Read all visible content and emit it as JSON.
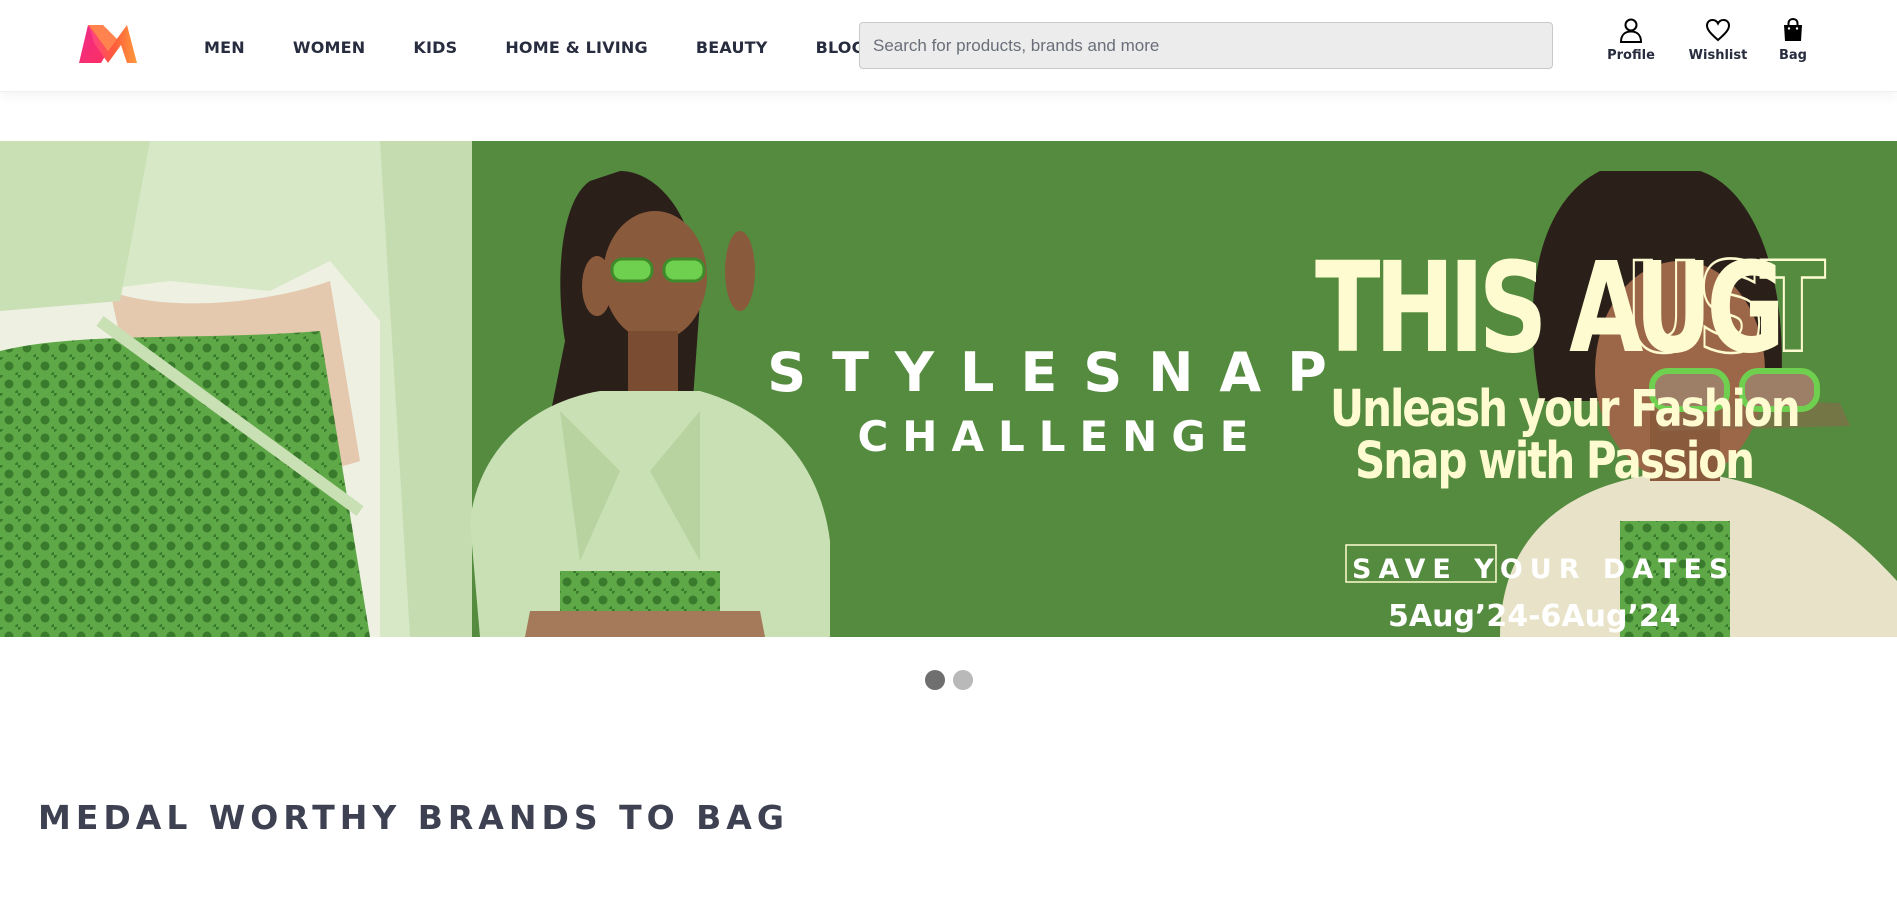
{
  "header": {
    "logo_icon": "myntra-logo-icon",
    "nav": [
      "MEN",
      "WOMEN",
      "KIDS",
      "HOME & LIVING",
      "BEAUTY",
      "BLOGS"
    ],
    "search": {
      "placeholder": "Search for products, brands and more"
    },
    "actions": [
      {
        "label": "Profile",
        "icon": "profile-icon"
      },
      {
        "label": "Wishlist",
        "icon": "heart-icon"
      },
      {
        "label": "Bag",
        "icon": "bag-icon"
      }
    ]
  },
  "banner": {
    "headline_1": "STYLESNAP",
    "headline_2": "CHALLENGE",
    "this": "THIS AUG",
    "this_outline": "UST",
    "tagline_1": "Unleash your Fashion",
    "tagline_2": "Snap with Passion",
    "save_dates": "SAVE YOUR DATES",
    "dates": "5Aug’24-6Aug’24",
    "colors": {
      "background": "#548b3f",
      "accent": "#fffbd1",
      "outfit": "#c9dfb4"
    }
  },
  "carousel": {
    "slides": 2,
    "active": 1
  },
  "section": {
    "title": "MEDAL WORTHY BRANDS TO BAG"
  }
}
